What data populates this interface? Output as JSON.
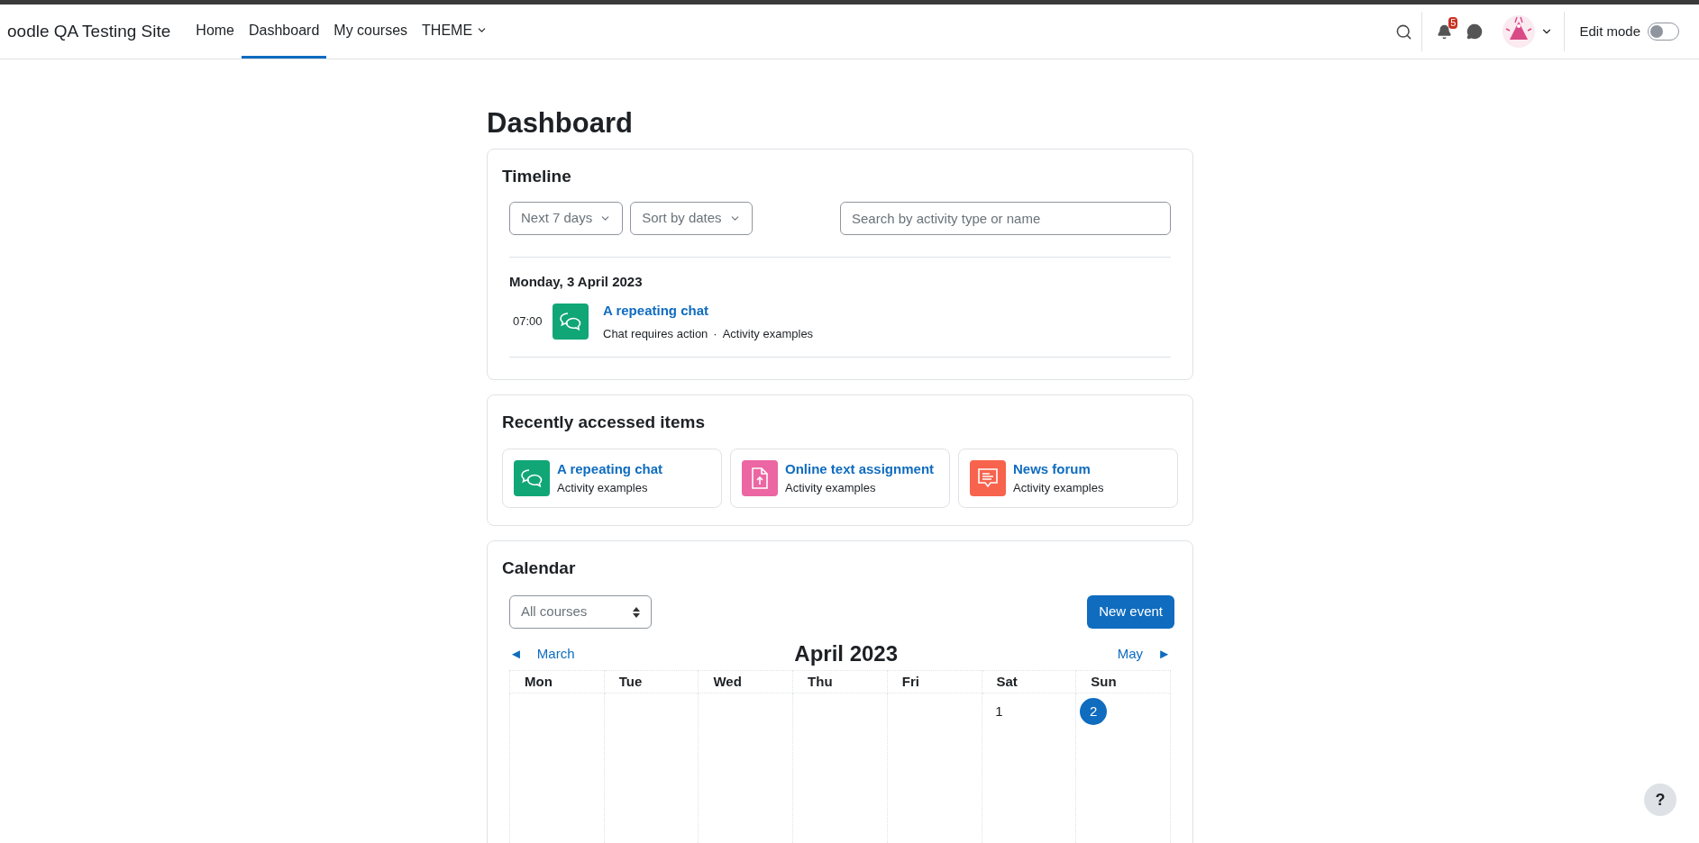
{
  "site_name": "oodle QA Testing Site",
  "nav": [
    {
      "label": "Home",
      "selected": false,
      "dropdown": false
    },
    {
      "label": "Dashboard",
      "selected": true,
      "dropdown": false
    },
    {
      "label": "My courses",
      "selected": false,
      "dropdown": false
    },
    {
      "label": "THEME",
      "selected": false,
      "dropdown": true
    }
  ],
  "notifications": {
    "count": "5"
  },
  "edit_mode": {
    "label": "Edit mode",
    "on": false
  },
  "page_title": "Dashboard",
  "timeline": {
    "title": "Timeline",
    "filters": [
      "Next 7 days",
      "Sort by dates"
    ],
    "search": {
      "placeholder": "Search by activity type or name"
    },
    "groups": [
      {
        "date": "Monday, 3 April 2023",
        "items": [
          {
            "time": "07:00",
            "kind": "chat",
            "title": "A repeating chat",
            "action": "Chat requires action",
            "separator": "·",
            "course": "Activity examples"
          }
        ]
      }
    ]
  },
  "recent": {
    "title": "Recently accessed items",
    "items": [
      {
        "kind": "chat",
        "title": "A repeating chat",
        "course": "Activity examples"
      },
      {
        "kind": "assign",
        "title": "Online text assignment",
        "course": "Activity examples"
      },
      {
        "kind": "forum",
        "title": "News forum",
        "course": "Activity examples"
      }
    ]
  },
  "calendar": {
    "title": "Calendar",
    "course_select": "All courses",
    "new_event": "New event",
    "prev": {
      "arrow": "◄",
      "label": "March"
    },
    "next": {
      "label": "May",
      "arrow": "►"
    },
    "month": "April 2023",
    "weekdays": [
      "Mon",
      "Tue",
      "Wed",
      "Thu",
      "Fri",
      "Sat",
      "Sun"
    ],
    "weeks": [
      [
        {
          "kind": "blank"
        },
        {
          "kind": "blank"
        },
        {
          "kind": "blank"
        },
        {
          "kind": "blank"
        },
        {
          "kind": "blank"
        },
        {
          "kind": "day",
          "day": "1",
          "today": false
        },
        {
          "kind": "day",
          "day": "2",
          "today": true
        }
      ]
    ]
  },
  "help": "?"
}
